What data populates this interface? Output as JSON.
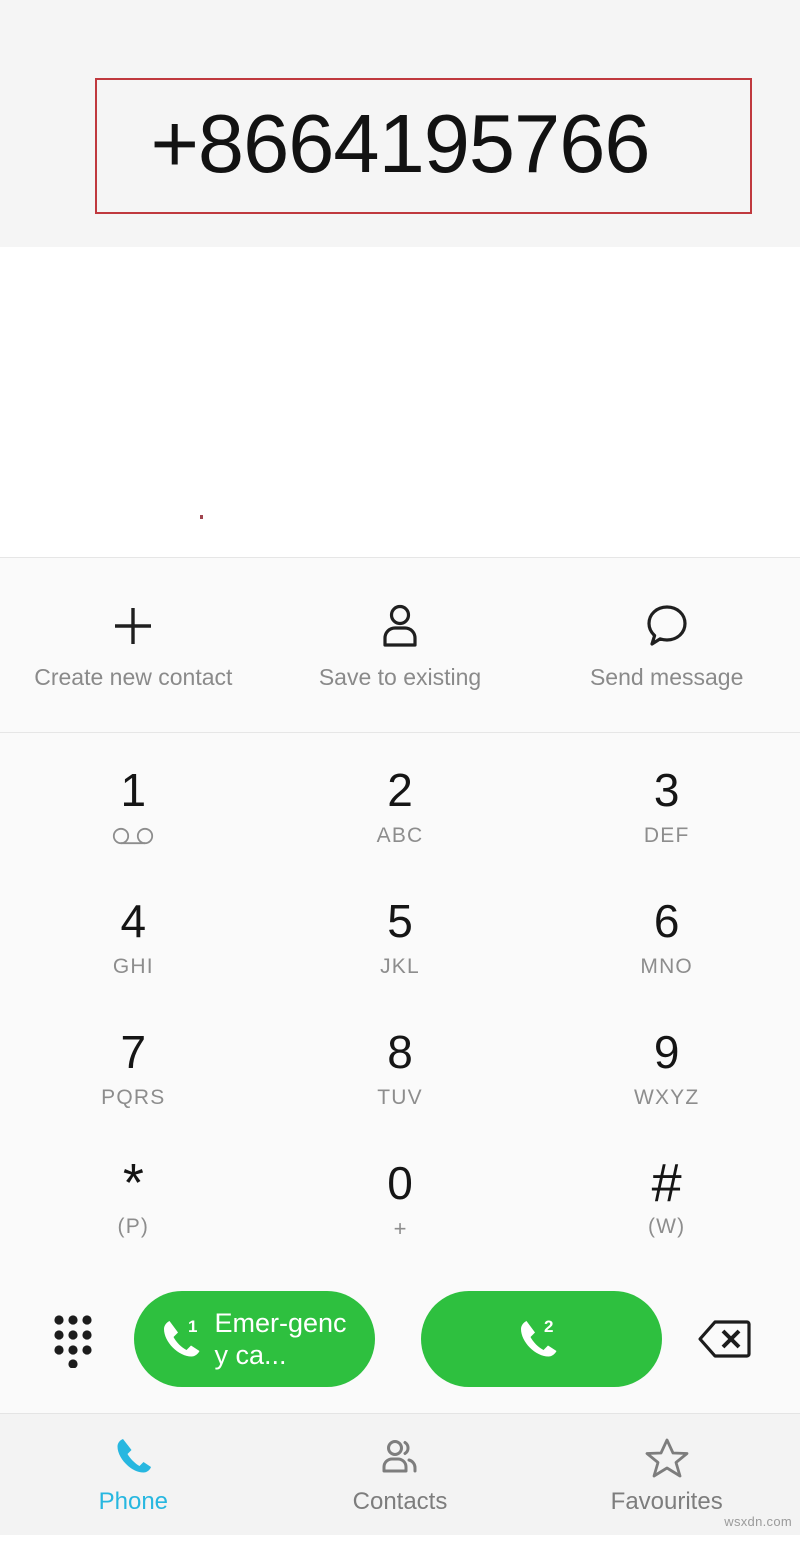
{
  "app": {
    "name": "Phone",
    "watermark": "wsxdn.com"
  },
  "display": {
    "number": "+8664195766",
    "highlight_color": "#c0393e"
  },
  "quick_actions": [
    {
      "label": "Create new contact",
      "icon": "plus-icon"
    },
    {
      "label": "Save to existing",
      "icon": "person-icon"
    },
    {
      "label": "Send message",
      "icon": "speech-bubble-icon"
    }
  ],
  "keypad": {
    "keys": [
      {
        "digit": "1",
        "sub": "",
        "icon": "voicemail-icon"
      },
      {
        "digit": "2",
        "sub": "ABC",
        "icon": ""
      },
      {
        "digit": "3",
        "sub": "DEF",
        "icon": ""
      },
      {
        "digit": "4",
        "sub": "GHI",
        "icon": ""
      },
      {
        "digit": "5",
        "sub": "JKL",
        "icon": ""
      },
      {
        "digit": "6",
        "sub": "MNO",
        "icon": ""
      },
      {
        "digit": "7",
        "sub": "PQRS",
        "icon": ""
      },
      {
        "digit": "8",
        "sub": "TUV",
        "icon": ""
      },
      {
        "digit": "9",
        "sub": "WXYZ",
        "icon": ""
      },
      {
        "digit": "*",
        "sub": "(P)",
        "icon": ""
      },
      {
        "digit": "0",
        "sub": "+",
        "icon": ""
      },
      {
        "digit": "#",
        "sub": "(W)",
        "icon": ""
      }
    ]
  },
  "call_bar": {
    "dialpad_toggle_icon": "dialpad-icon",
    "backspace_icon": "backspace-icon",
    "buttons": [
      {
        "sim": "1",
        "label": "Emer-gency ca...",
        "color": "#2ec03f",
        "icon": "call-icon"
      },
      {
        "sim": "2",
        "label": "",
        "color": "#2ec03f",
        "icon": "call-icon"
      }
    ]
  },
  "bottom_nav": {
    "active": "Phone",
    "items": [
      {
        "label": "Phone",
        "icon": "phone-handset-icon",
        "active": true
      },
      {
        "label": "Contacts",
        "icon": "people-icon",
        "active": false
      },
      {
        "label": "Favourites",
        "icon": "star-icon",
        "active": false
      }
    ]
  }
}
